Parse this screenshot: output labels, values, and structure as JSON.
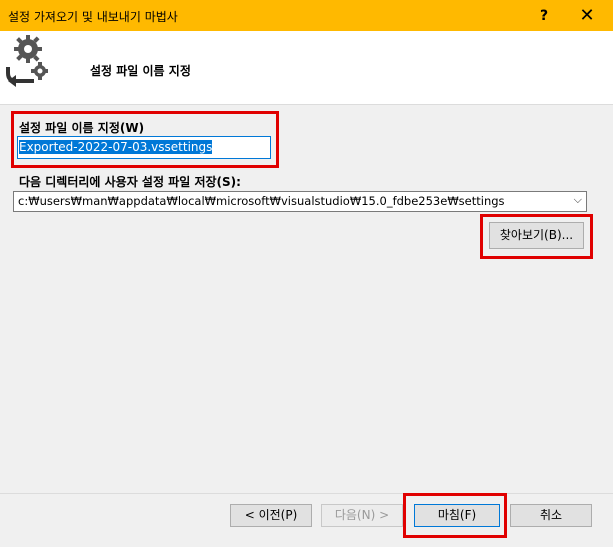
{
  "window": {
    "title": "설정 가져오기 및 내보내기 마법사",
    "help_label": "?",
    "close_label": "✕",
    "accent_color": "#ffb900"
  },
  "header": {
    "title": "설정 파일 이름 지정",
    "icon": "gears-export-icon"
  },
  "form": {
    "name_label": "설정 파일 이름 지정(W)",
    "name_value": "Exported-2022-07-03.vssettings",
    "dir_label": "다음 디렉터리에 사용자 설정 파일 저장(S):",
    "dir_value": "c:₩users₩man₩appdata₩local₩microsoft₩visualstudio₩15.0_fdbe253e₩settings",
    "browse_label": "찾아보기(B)..."
  },
  "footer": {
    "prev_label": "< 이전(P)",
    "next_label": "다음(N) >",
    "finish_label": "마침(F)",
    "cancel_label": "취소"
  }
}
